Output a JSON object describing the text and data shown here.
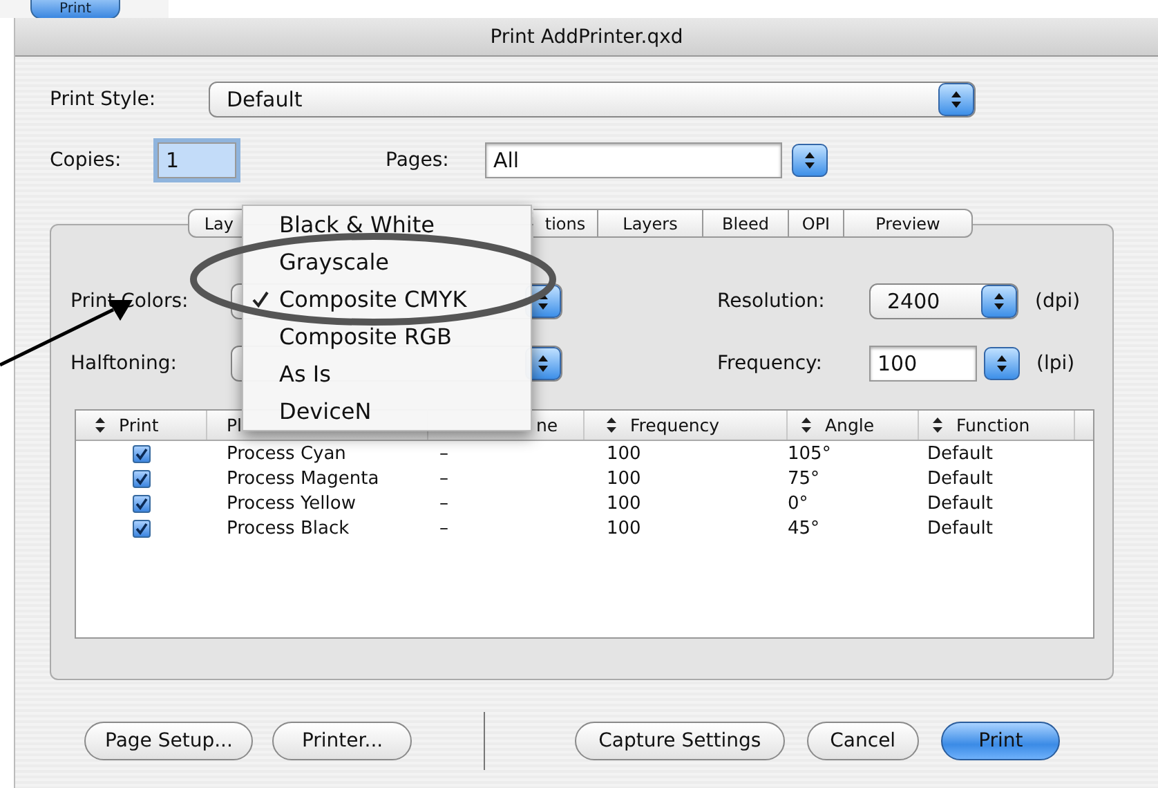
{
  "background_window": {
    "button": "Print"
  },
  "window": {
    "title": "Print AddPrinter.qxd"
  },
  "print_style": {
    "label": "Print Style:",
    "value": "Default"
  },
  "copies": {
    "label": "Copies:",
    "value": "1"
  },
  "pages": {
    "label": "Pages:",
    "value": "All"
  },
  "tabs": [
    {
      "label": "Lay"
    },
    {
      "label": "tions"
    },
    {
      "label": "Layers"
    },
    {
      "label": "Bleed"
    },
    {
      "label": "OPI"
    },
    {
      "label": "Preview"
    }
  ],
  "print_colors": {
    "label": "Print Colors:"
  },
  "halftoning": {
    "label": "Halftoning:"
  },
  "resolution": {
    "label": "Resolution:",
    "value": "2400",
    "unit": "(dpi)"
  },
  "frequency": {
    "label": "Frequency:",
    "value": "100",
    "unit": "(lpi)"
  },
  "table": {
    "columns": [
      {
        "label": "Print",
        "sortable": true
      },
      {
        "label": "Pl",
        "sortable": false
      },
      {
        "label": "ne",
        "sortable": false
      },
      {
        "label": "Frequency",
        "sortable": true
      },
      {
        "label": "Angle",
        "sortable": true
      },
      {
        "label": "Function",
        "sortable": true
      }
    ],
    "rows": [
      {
        "print": true,
        "plate": "Process Cyan",
        "halftone": "–",
        "frequency": "100",
        "angle": "105°",
        "function": "Default"
      },
      {
        "print": true,
        "plate": "Process Magenta",
        "halftone": "–",
        "frequency": "100",
        "angle": "75°",
        "function": "Default"
      },
      {
        "print": true,
        "plate": "Process Yellow",
        "halftone": "–",
        "frequency": "100",
        "angle": "0°",
        "function": "Default"
      },
      {
        "print": true,
        "plate": "Process Black",
        "halftone": "–",
        "frequency": "100",
        "angle": "45°",
        "function": "Default"
      }
    ]
  },
  "color_menu": {
    "items": [
      {
        "label": "Black & White",
        "selected": false
      },
      {
        "label": "Grayscale",
        "selected": false
      },
      {
        "label": "Composite CMYK",
        "selected": true
      },
      {
        "label": "Composite RGB",
        "selected": false
      },
      {
        "label": "As Is",
        "selected": false
      },
      {
        "label": "DeviceN",
        "selected": false
      }
    ]
  },
  "buttons_left": [
    {
      "label": "Page Setup...",
      "default": false
    },
    {
      "label": "Printer...",
      "default": false
    }
  ],
  "buttons_right": [
    {
      "label": "Capture Settings",
      "default": false
    },
    {
      "label": "Cancel",
      "default": false
    },
    {
      "label": "Print",
      "default": true
    }
  ]
}
